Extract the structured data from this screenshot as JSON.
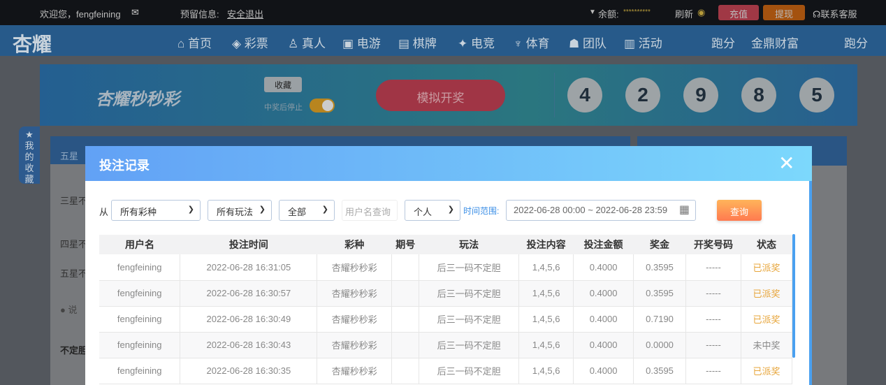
{
  "topbar": {
    "welcome": "欢迎您，fengfeining",
    "reserved": "预留信息:",
    "logout": "安全退出",
    "balance_label": "余额:",
    "balance": "**********",
    "refresh": "刷新",
    "deposit": "充值",
    "withdraw": "提现",
    "support": "联系客服"
  },
  "nav": {
    "logo": "杏耀",
    "items": [
      "首页",
      "彩票",
      "真人",
      "电游",
      "棋牌",
      "电竞",
      "体育",
      "团队",
      "活动",
      "跑分",
      "金鼎财富",
      "跑分"
    ]
  },
  "banner": {
    "title": "杏耀秒秒彩",
    "favorite": "收藏",
    "stop_after_win": "中奖后停止",
    "simulate": "模拟开奖",
    "balls": [
      "4",
      "2",
      "9",
      "8",
      "5"
    ]
  },
  "side": {
    "favorites": "我的收藏",
    "rows": [
      "五星",
      "三星不",
      "四星不",
      "五星不",
      "说",
      "不定胆"
    ]
  },
  "modal": {
    "title": "投注记录",
    "from": "从",
    "lottery": "所有彩种",
    "play": "所有玩法",
    "scope": "全部",
    "username_placeholder": "用户名查询",
    "person": "个人",
    "time_label": "时间范围:",
    "time_range": "2022-06-28 00:00 ~ 2022-06-28 23:59",
    "query": "查询",
    "columns": [
      "用户名",
      "投注时间",
      "彩种",
      "期号",
      "玩法",
      "投注内容",
      "投注金额",
      "奖金",
      "开奖号码",
      "状态"
    ],
    "rows": [
      [
        "fengfeining",
        "2022-06-28 16:31:05",
        "杏耀秒秒彩",
        "",
        "后三一码不定胆",
        "1,4,5,6",
        "0.4000",
        "0.3595",
        "-----",
        "已派奖"
      ],
      [
        "fengfeining",
        "2022-06-28 16:30:57",
        "杏耀秒秒彩",
        "",
        "后三一码不定胆",
        "1,4,5,6",
        "0.4000",
        "0.3595",
        "-----",
        "已派奖"
      ],
      [
        "fengfeining",
        "2022-06-28 16:30:49",
        "杏耀秒秒彩",
        "",
        "后三一码不定胆",
        "1,4,5,6",
        "0.4000",
        "0.7190",
        "-----",
        "已派奖"
      ],
      [
        "fengfeining",
        "2022-06-28 16:30:43",
        "杏耀秒秒彩",
        "",
        "后三一码不定胆",
        "1,4,5,6",
        "0.4000",
        "0.0000",
        "-----",
        "未中奖"
      ],
      [
        "fengfeining",
        "2022-06-28 16:30:35",
        "杏耀秒秒彩",
        "",
        "后三一码不定胆",
        "1,4,5,6",
        "0.4000",
        "0.3595",
        "-----",
        "已派奖"
      ]
    ]
  }
}
